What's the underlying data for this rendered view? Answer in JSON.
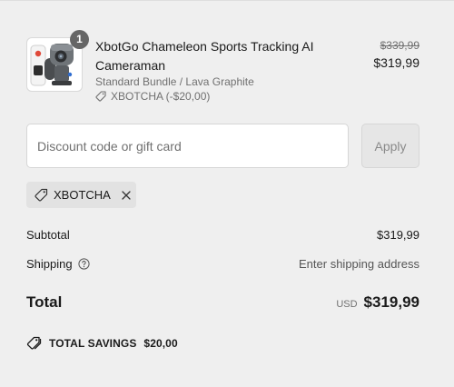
{
  "product": {
    "quantity": "1",
    "name": "XbotGo Chameleon Sports Tracking AI Cameraman",
    "variant": "Standard Bundle / Lava Graphite",
    "discount_label": "XBOTCHA (-$20,00)",
    "original_price": "$339,99",
    "price": "$319,99",
    "thumbnail_icon": "product-camera-image"
  },
  "discount": {
    "placeholder": "Discount code or gift card",
    "value": "",
    "apply_label": "Apply"
  },
  "applied_code": {
    "code": "XBOTCHA"
  },
  "summary": {
    "subtotal_label": "Subtotal",
    "subtotal_value": "$319,99",
    "shipping_label": "Shipping",
    "shipping_value": "Enter shipping address",
    "total_label": "Total",
    "total_currency": "USD",
    "total_value": "$319,99"
  },
  "savings": {
    "label": "TOTAL SAVINGS",
    "value": "$20,00"
  },
  "colors": {
    "background": "#efefef",
    "badge": "#666666",
    "muted_text": "#707070",
    "chip": "#e2e2e2"
  }
}
